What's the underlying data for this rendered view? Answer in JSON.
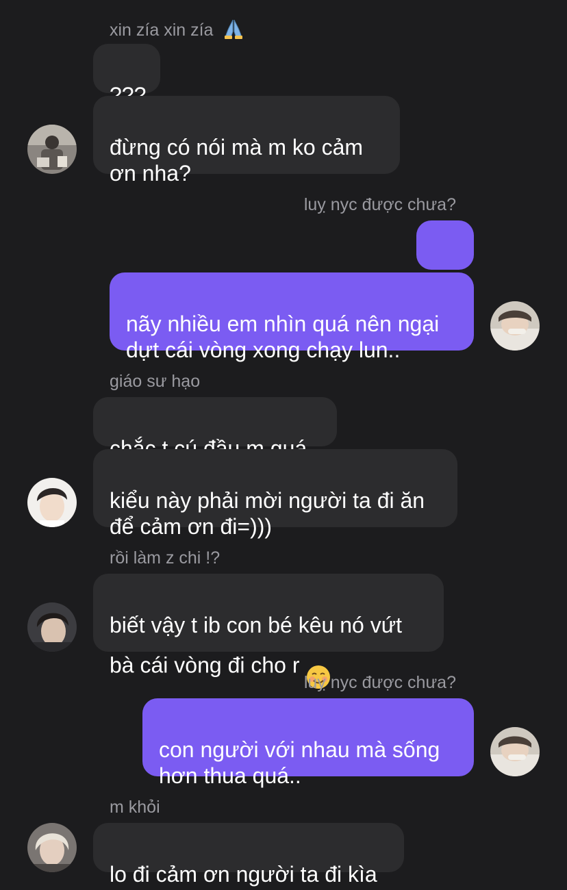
{
  "messages": [
    {
      "sender": "xin zía xin zía",
      "text": "???",
      "direction": "incoming"
    },
    {
      "text": "đừng có nói mà m ko cảm\nơn nha?",
      "direction": "incoming"
    },
    {
      "sender": "luỵ nyc được chưa?",
      "text": "....",
      "direction": "outgoing"
    },
    {
      "text": "nãy nhiều em nhìn quá nên ngại\ndựt cái vòng xong chạy lun..",
      "direction": "outgoing"
    },
    {
      "sender": "giáo sư hạo",
      "text": "chắc t cú đầu m quá",
      "direction": "incoming"
    },
    {
      "text": "kiểu này phải mời người ta đi ăn\nđể cảm ơn đi=)))",
      "direction": "incoming"
    },
    {
      "sender": "rồi làm z chi !?",
      "text": "biết vậy t ib con bé kêu nó vứt\nbà cái vòng đi cho r ",
      "direction": "incoming",
      "emoji": "smiling-face-icon"
    },
    {
      "sender": "luỵ nyc được chưa?",
      "text": "con người với nhau mà sống\nhơn thua quá..",
      "direction": "outgoing"
    },
    {
      "sender": "m khỏi",
      "text": "lo đi cảm ơn người ta đi kìa",
      "direction": "incoming"
    }
  ],
  "icons": {
    "sender_emoji": "folded-hands-icon",
    "avatar": "user-avatar-photo"
  },
  "colors": {
    "background": "#1c1c1e",
    "incoming_bubble": "#2c2c2e",
    "outgoing_bubble": "#7b5cf2",
    "sender_text": "#9a9aa0"
  }
}
